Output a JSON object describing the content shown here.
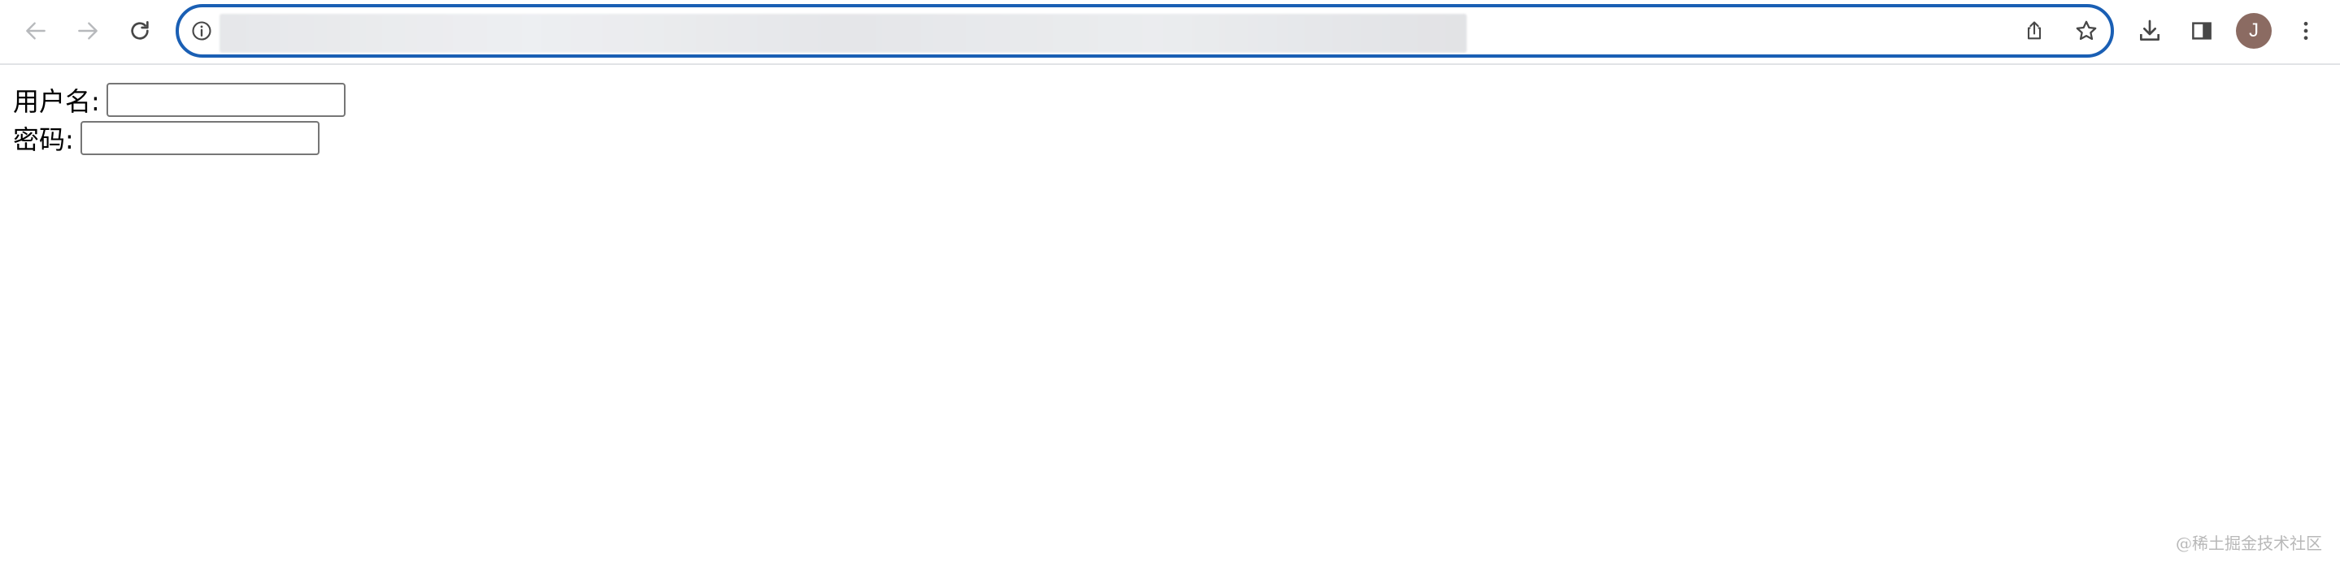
{
  "browser": {
    "avatar_initial": "J",
    "icons": {
      "back": "arrow-left-icon",
      "forward": "arrow-right-icon",
      "reload": "reload-icon",
      "site_info": "info-icon",
      "share": "share-icon",
      "bookmark": "star-icon",
      "download": "download-icon",
      "side_panel": "side-panel-icon",
      "menu": "kebab-menu-icon"
    },
    "accent_color": "#1a5fb4",
    "avatar_color": "#8b6b62"
  },
  "form": {
    "username_label": "用户名:",
    "username_value": "",
    "password_label": "密码:",
    "password_value": ""
  },
  "watermark": "@稀土掘金技术社区"
}
